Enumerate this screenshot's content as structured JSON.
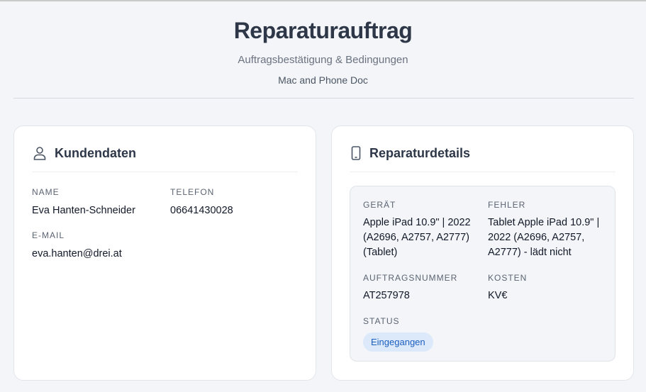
{
  "header": {
    "title": "Reparaturauftrag",
    "subtitle": "Auftragsbestätigung & Bedingungen",
    "company": "Mac and Phone Doc"
  },
  "customer": {
    "heading": "Kundendaten",
    "icon": "user-icon",
    "name_label": "NAME",
    "name": "Eva Hanten-Schneider",
    "phone_label": "TELEFON",
    "phone": "06641430028",
    "email_label": "E-MAIL",
    "email": "eva.hanten@drei.at"
  },
  "repair": {
    "heading": "Reparaturdetails",
    "icon": "phone-icon",
    "device_label": "GERÄT",
    "device": "Apple iPad 10.9\" | 2022 (A2696, A2757, A2777) (Tablet)",
    "fault_label": "FEHLER",
    "fault": "Tablet Apple iPad 10.9\" | 2022 (A2696, A2757, A2777) - lädt nicht",
    "order_label": "AUFTRAGSNUMMER",
    "order_number": "AT257978",
    "cost_label": "KOSTEN",
    "cost": "KV€",
    "status_label": "STATUS",
    "status": "Eingegangen",
    "status_color": "#1d5fbf"
  }
}
